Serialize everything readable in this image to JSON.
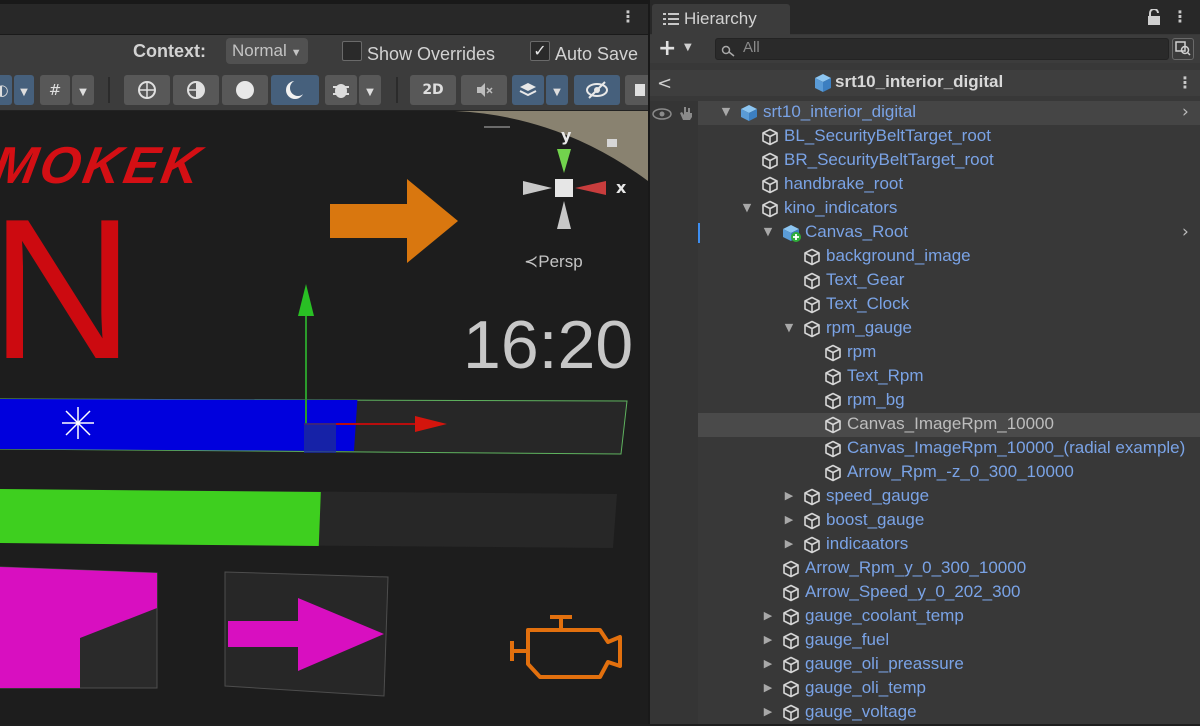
{
  "scene_view": {
    "context_label": "Context:",
    "context_value": "Normal",
    "show_overrides_label": "Show Overrides",
    "auto_save_label": "Auto Save",
    "auto_save_checked": "✓",
    "btn_2d": "2D",
    "persp_label": "Persp",
    "gizmo_y": "y",
    "gizmo_x": "x",
    "overlay_text_brand": "MOKEK",
    "overlay_gear": "N",
    "overlay_clock": "16:20",
    "rpm_fill_fraction": 0.57,
    "boost_fill_fraction": 0.52,
    "colors": {
      "red_text": "#d40f14",
      "orange_arrow": "#d9770f",
      "blue_bar": "#0000dd",
      "green_bar": "#3ecf1f",
      "magenta": "#d80fc0",
      "engine_icon": "#e2700e"
    }
  },
  "hierarchy": {
    "tab_label": "Hierarchy",
    "search_placeholder": "All",
    "scene_title": "srt10_interior_digital",
    "items": [
      {
        "label": "srt10_interior_digital",
        "depth": 0,
        "fold": "open",
        "icon": "prefab-icon",
        "root": true
      },
      {
        "label": "BL_SecurityBeltTarget_root",
        "depth": 1,
        "fold": "",
        "icon": "gameobject-icon"
      },
      {
        "label": "BR_SecurityBeltTarget_root",
        "depth": 1,
        "fold": "",
        "icon": "gameobject-icon"
      },
      {
        "label": "handbrake_root",
        "depth": 1,
        "fold": "",
        "icon": "gameobject-icon"
      },
      {
        "label": "kino_indicators",
        "depth": 1,
        "fold": "open",
        "icon": "gameobject-icon"
      },
      {
        "label": "Canvas_Root",
        "depth": 2,
        "fold": "open",
        "icon": "prefab-added-icon"
      },
      {
        "label": "background_image",
        "depth": 3,
        "fold": "",
        "icon": "gameobject-icon"
      },
      {
        "label": "Text_Gear",
        "depth": 3,
        "fold": "",
        "icon": "gameobject-icon"
      },
      {
        "label": "Text_Clock",
        "depth": 3,
        "fold": "",
        "icon": "gameobject-icon"
      },
      {
        "label": "rpm_gauge",
        "depth": 3,
        "fold": "open",
        "icon": "gameobject-icon"
      },
      {
        "label": "rpm",
        "depth": 4,
        "fold": "",
        "icon": "gameobject-icon"
      },
      {
        "label": "Text_Rpm",
        "depth": 4,
        "fold": "",
        "icon": "gameobject-icon"
      },
      {
        "label": "rpm_bg",
        "depth": 4,
        "fold": "",
        "icon": "gameobject-icon"
      },
      {
        "label": "Canvas_ImageRpm_10000",
        "depth": 4,
        "fold": "",
        "icon": "gameobject-icon",
        "selected": true
      },
      {
        "label": "Canvas_ImageRpm_10000_(radial example)",
        "depth": 4,
        "fold": "",
        "icon": "gameobject-icon"
      },
      {
        "label": "Arrow_Rpm_-z_0_300_10000",
        "depth": 4,
        "fold": "",
        "icon": "gameobject-icon"
      },
      {
        "label": "speed_gauge",
        "depth": 3,
        "fold": "closed",
        "icon": "gameobject-icon"
      },
      {
        "label": "boost_gauge",
        "depth": 3,
        "fold": "closed",
        "icon": "gameobject-icon"
      },
      {
        "label": "indicaators",
        "depth": 3,
        "fold": "closed",
        "icon": "gameobject-icon"
      },
      {
        "label": "Arrow_Rpm_y_0_300_10000",
        "depth": 2,
        "fold": "",
        "icon": "gameobject-icon"
      },
      {
        "label": "Arrow_Speed_y_0_202_300",
        "depth": 2,
        "fold": "",
        "icon": "gameobject-icon"
      },
      {
        "label": "gauge_coolant_temp",
        "depth": 2,
        "fold": "closed",
        "icon": "gameobject-icon"
      },
      {
        "label": "gauge_fuel",
        "depth": 2,
        "fold": "closed",
        "icon": "gameobject-icon"
      },
      {
        "label": "gauge_oli_preassure",
        "depth": 2,
        "fold": "closed",
        "icon": "gameobject-icon"
      },
      {
        "label": "gauge_oli_temp",
        "depth": 2,
        "fold": "closed",
        "icon": "gameobject-icon"
      },
      {
        "label": "gauge_voltage",
        "depth": 2,
        "fold": "closed",
        "icon": "gameobject-icon"
      }
    ]
  }
}
